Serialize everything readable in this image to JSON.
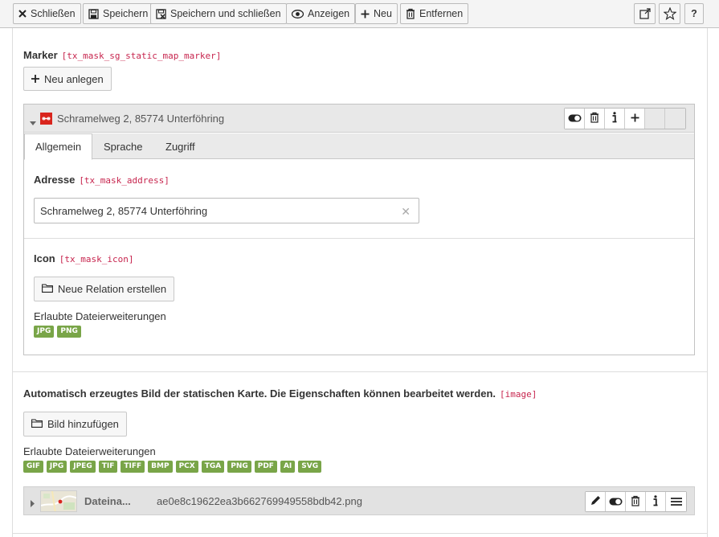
{
  "toolbar": {
    "close": "Schließen",
    "save": "Speichern",
    "save_close": "Speichern und schließen",
    "view": "Anzeigen",
    "new": "Neu",
    "delete": "Entfernen",
    "help": "?"
  },
  "marker_field": {
    "label": "Marker",
    "key": "[tx_mask_sg_static_map_marker]",
    "create_button": "Neu anlegen"
  },
  "record": {
    "title": "Schramelweg 2, 85774 Unterföhring",
    "tabs": [
      "Allgemein",
      "Sprache",
      "Zugriff"
    ],
    "active_tab": "Allgemein",
    "address": {
      "label": "Adresse",
      "key": "[tx_mask_address]",
      "value": "Schramelweg 2, 85774 Unterföhring"
    },
    "icon": {
      "label": "Icon",
      "key": "[tx_mask_icon]",
      "button": "Neue Relation erstellen",
      "allowed_label": "Erlaubte Dateierweiterungen",
      "extensions": [
        "JPG",
        "PNG"
      ]
    }
  },
  "image_field": {
    "label": "Automatisch erzeugtes Bild der statischen Karte. Die Eigenschaften können bearbeitet werden.",
    "key": "[image]",
    "button": "Bild hinzufügen",
    "allowed_label": "Erlaubte Dateierweiterungen",
    "extensions": [
      "GIF",
      "JPG",
      "JPEG",
      "TIF",
      "TIFF",
      "BMP",
      "PCX",
      "TGA",
      "PNG",
      "PDF",
      "AI",
      "SVG"
    ]
  },
  "file": {
    "label": "Dateina...",
    "name": "ae0e8c19622ea3b662769949558bdb42.png"
  },
  "colors": {
    "badge": "#79a548",
    "tag": "#c7254e",
    "record_icon": "#d9251d"
  }
}
